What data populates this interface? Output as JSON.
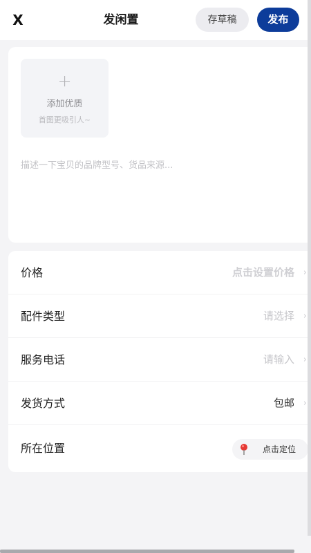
{
  "header": {
    "close_label": "X",
    "title": "发闲置",
    "draft_label": "存草稿",
    "publish_label": "发布"
  },
  "upload": {
    "plus_glyph": "+",
    "label": "添加优质",
    "sublabel": "首图更吸引人~"
  },
  "description": {
    "placeholder": "描述一下宝贝的品牌型号、货品来源...",
    "value": ""
  },
  "form": {
    "rows": [
      {
        "label": "价格",
        "value": "点击设置价格"
      },
      {
        "label": "配件类型",
        "value": "请选择"
      },
      {
        "label": "服务电话",
        "value": "请输入"
      },
      {
        "label": "发货方式",
        "value": "包邮"
      },
      {
        "label": "所在位置",
        "value": "点击定位"
      }
    ],
    "chevron": "›"
  },
  "colors": {
    "accent": "#0d3c9a",
    "pin": "#e53935"
  }
}
